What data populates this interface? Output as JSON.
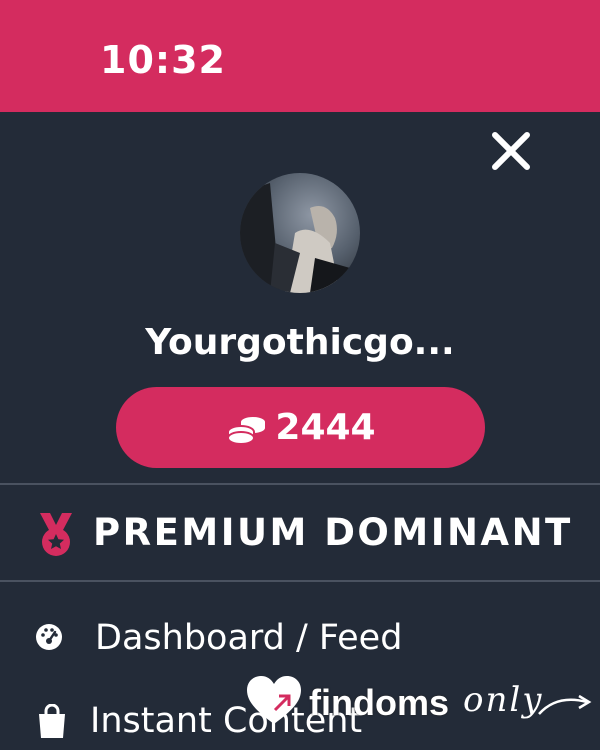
{
  "status_bar": {
    "time": "10:32"
  },
  "profile": {
    "username": "Yourgothicgo...",
    "coins": "2444"
  },
  "rank": {
    "label": "PREMIUM DOMINANT"
  },
  "menu": {
    "items": [
      {
        "label": "Dashboard / Feed",
        "icon": "dashboard-gauge-icon"
      },
      {
        "label": "Instant Content",
        "icon": "shopping-bag-icon"
      }
    ]
  },
  "logo": {
    "part1": "findoms",
    "part2": "only"
  },
  "colors": {
    "accent": "#d42c5f",
    "background": "#232b38",
    "divider": "#4a5260",
    "text": "#ffffff"
  }
}
